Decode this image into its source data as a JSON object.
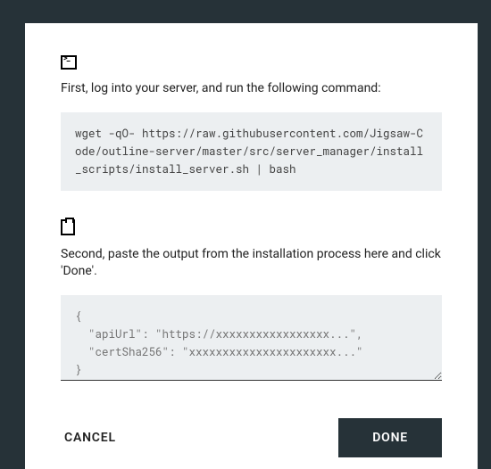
{
  "step1": {
    "instruction": "First, log into your server, and run the following command:",
    "command": "wget -qO- https://raw.githubusercontent.com/Jigsaw-Code/outline-server/master/src/server_manager/install_scripts/install_server.sh | bash"
  },
  "step2": {
    "instruction": "Second, paste the output from the installation process here and click 'Done'.",
    "placeholder": "{\n  \"apiUrl\": \"https://xxxxxxxxxxxxxxxxx...\",\n  \"certSha256\": \"xxxxxxxxxxxxxxxxxxxxxx...\"\n}"
  },
  "buttons": {
    "cancel": "CANCEL",
    "done": "DONE"
  }
}
